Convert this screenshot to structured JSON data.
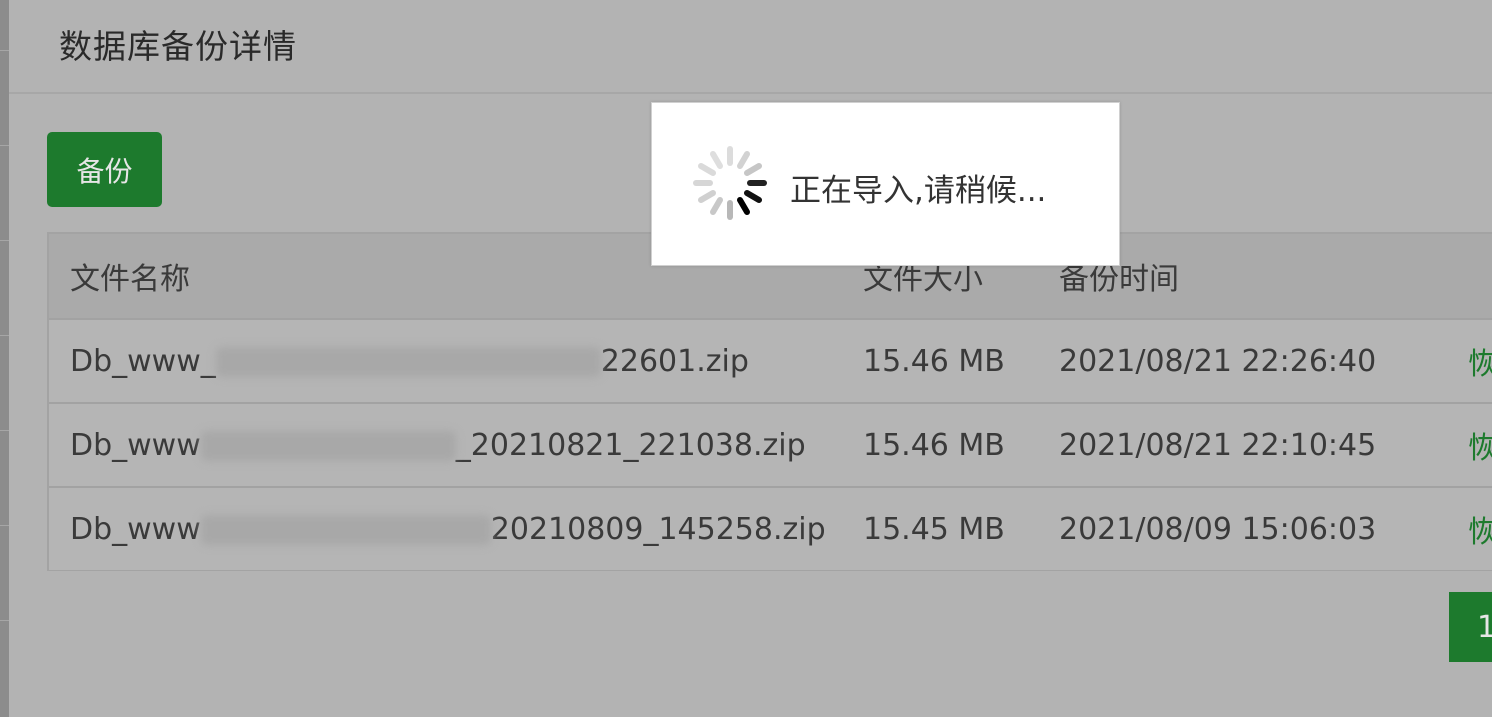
{
  "header": {
    "title": "数据库备份详情"
  },
  "toolbar": {
    "backup_label": "备份"
  },
  "table": {
    "columns": [
      "文件名称",
      "文件大小",
      "备份时间"
    ],
    "rows": [
      {
        "name_prefix": "Db_www_",
        "name_suffix": "22601.zip",
        "size": "15.46 MB",
        "time": "2021/08/21 22:26:40",
        "action": "恢"
      },
      {
        "name_prefix": "Db_www",
        "name_suffix": "_20210821_221038.zip",
        "size": "15.46 MB",
        "time": "2021/08/21 22:10:45",
        "action": "恢"
      },
      {
        "name_prefix": "Db_www",
        "name_suffix": "20210809_145258.zip",
        "size": "15.45 MB",
        "time": "2021/08/09 15:06:03",
        "action": "恢"
      }
    ]
  },
  "pagination": {
    "current": "1"
  },
  "loading": {
    "message": "正在导入,请稍候...",
    "icon": "spinner-icon"
  },
  "colors": {
    "accent": "#1d7a2d",
    "overlay_bg": "#b3b3b3",
    "toast_bg": "#ffffff"
  }
}
